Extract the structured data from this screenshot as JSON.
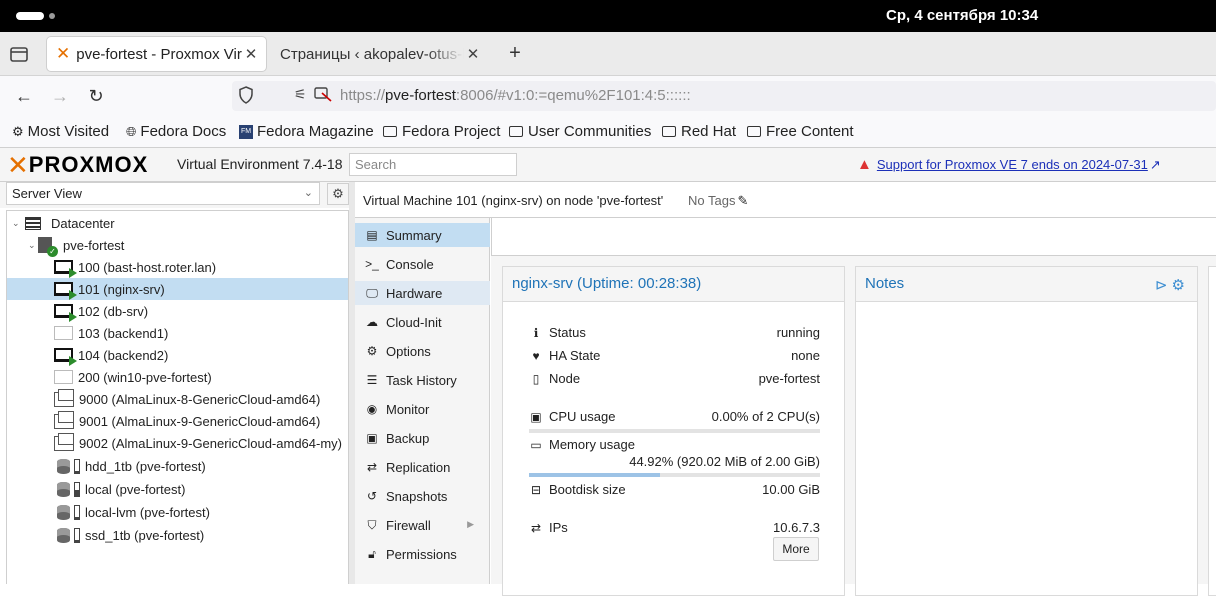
{
  "system_bar": {
    "clock": "Ср, 4 сентября  10:34"
  },
  "browser": {
    "tabs": [
      {
        "title": "pve-fortest - Proxmox Virtual Environment",
        "active": true
      },
      {
        "title": "Страницы ‹ akopalev-otus-hw",
        "active": false
      }
    ],
    "url_prefix": "https://",
    "url_host": "pve-fortest",
    "url_rest": ":8006/#v1:0:=qemu%2F101:4:5::::::",
    "bookmarks": [
      "Most Visited",
      "Fedora Docs",
      "Fedora Magazine",
      "Fedora Project",
      "User Communities",
      "Red Hat",
      "Free Content"
    ]
  },
  "pve": {
    "logo_text": "PROXMOX",
    "version": "Virtual Environment 7.4-18",
    "search_placeholder": "Search",
    "support_notice": "Support for Proxmox VE 7 ends on 2024-07-31",
    "view_selector": "Server View"
  },
  "tree": {
    "datacenter": "Datacenter",
    "node": "pve-fortest",
    "vms": [
      {
        "label": "100 (bast-host.roter.lan)",
        "state": "running"
      },
      {
        "label": "101 (nginx-srv)",
        "state": "running",
        "selected": true
      },
      {
        "label": "102 (db-srv)",
        "state": "running"
      },
      {
        "label": "103 (backend1)",
        "state": "stopped"
      },
      {
        "label": "104 (backend2)",
        "state": "running"
      },
      {
        "label": "200 (win10-pve-fortest)",
        "state": "stopped"
      }
    ],
    "templates": [
      {
        "label": "9000 (AlmaLinux-8-GenericCloud-amd64)"
      },
      {
        "label": "9001 (AlmaLinux-9-GenericCloud-amd64)"
      },
      {
        "label": "9002 (AlmaLinux-9-GenericCloud-amd64-my)"
      }
    ],
    "storages": [
      {
        "label": "hdd_1tb (pve-fortest)"
      },
      {
        "label": "local (pve-fortest)"
      },
      {
        "label": "local-lvm (pve-fortest)"
      },
      {
        "label": "ssd_1tb (pve-fortest)"
      }
    ]
  },
  "vm": {
    "title": "Virtual Machine 101 (nginx-srv) on node 'pve-fortest'",
    "tags": "No Tags",
    "menu": [
      {
        "label": "Summary",
        "icon": "book-icon"
      },
      {
        "label": "Console",
        "icon": "terminal-icon"
      },
      {
        "label": "Hardware",
        "icon": "desktop-icon"
      },
      {
        "label": "Cloud-Init",
        "icon": "cloud-icon"
      },
      {
        "label": "Options",
        "icon": "gear-icon"
      },
      {
        "label": "Task History",
        "icon": "list-icon"
      },
      {
        "label": "Monitor",
        "icon": "eye-icon"
      },
      {
        "label": "Backup",
        "icon": "save-icon"
      },
      {
        "label": "Replication",
        "icon": "retweet-icon"
      },
      {
        "label": "Snapshots",
        "icon": "history-icon"
      },
      {
        "label": "Firewall",
        "icon": "shield-icon"
      },
      {
        "label": "Permissions",
        "icon": "unlock-icon"
      }
    ],
    "status_panel": {
      "title": "nginx-srv (Uptime: 00:28:38)",
      "status_label": "Status",
      "status_value": "running",
      "ha_label": "HA State",
      "ha_value": "none",
      "node_label": "Node",
      "node_value": "pve-fortest",
      "cpu_label": "CPU usage",
      "cpu_value": "0.00% of 2 CPU(s)",
      "cpu_fraction": 0.0,
      "mem_label": "Memory usage",
      "mem_value": "44.92% (920.02 MiB of 2.00 GiB)",
      "mem_fraction": 0.4492,
      "disk_label": "Bootdisk size",
      "disk_value": "10.00 GiB",
      "ips_label": "IPs",
      "ips_value": "10.6.7.3",
      "more_label": "More"
    },
    "notes_panel": {
      "title": "Notes"
    }
  }
}
